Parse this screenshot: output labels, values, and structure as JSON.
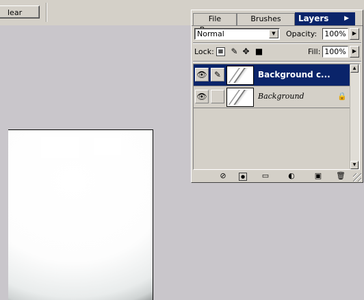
{
  "options_bar": {
    "clear_label": "lear"
  },
  "palette": {
    "tabs": [
      {
        "label": "File Browser"
      },
      {
        "label": "Brushes"
      },
      {
        "label": "Layers"
      }
    ],
    "tab_menu_arrow": "▶",
    "blend_mode": "Normal",
    "opacity_label": "Opacity:",
    "opacity_value": "100%",
    "lock_label": "Lock:",
    "fill_label": "Fill:",
    "fill_value": "100%",
    "layers": [
      {
        "name": "Background c...",
        "selected": true,
        "locked": false
      },
      {
        "name": "Background",
        "selected": false,
        "locked": true
      }
    ],
    "bottom_icons": [
      "layer-style-icon",
      "mask-icon",
      "folder-icon",
      "adjustment-icon",
      "new-layer-icon",
      "trash-icon"
    ]
  },
  "colors": {
    "selection": "#0a246a",
    "panel": "#d4d0c8",
    "workspace": "#c9c6cb"
  }
}
